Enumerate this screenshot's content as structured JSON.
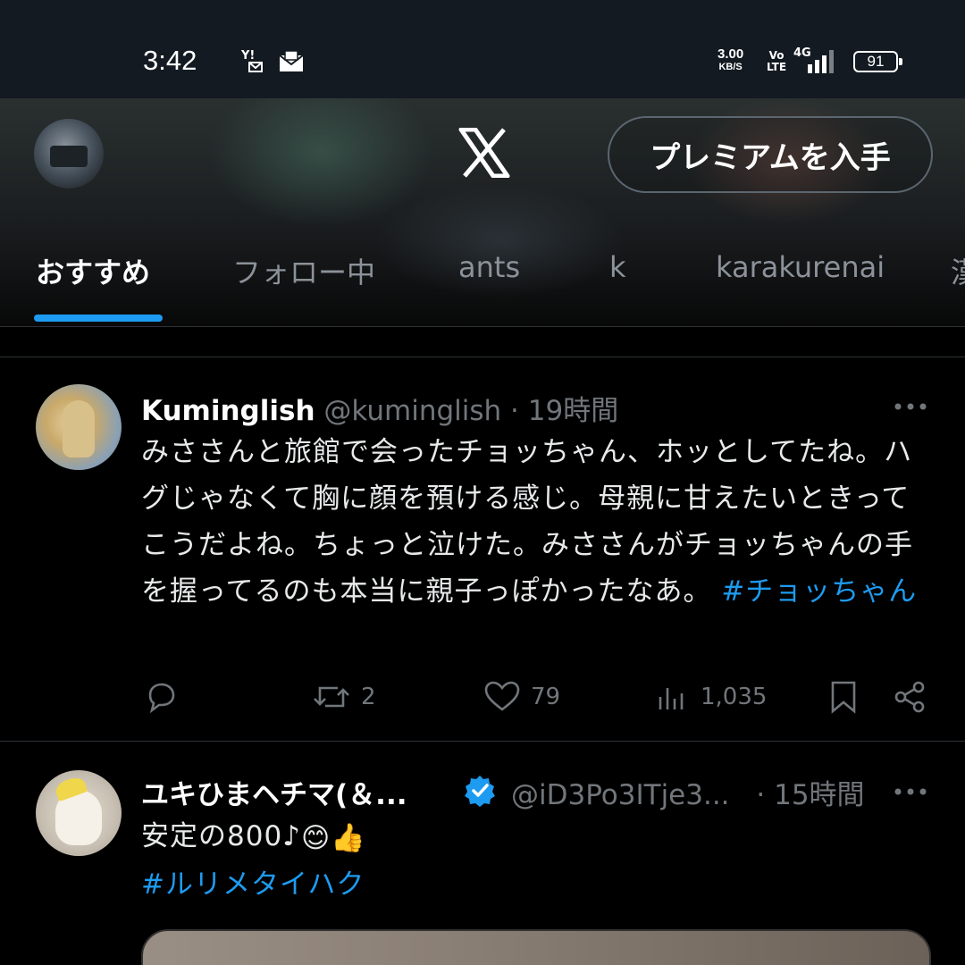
{
  "status_bar": {
    "time": "3:42",
    "notif_icon_1": "Y!",
    "notif_icon_2": "mail-icon",
    "net_speed_value": "3.00",
    "net_speed_unit": "KB/S",
    "volte_top": "Vo",
    "volte_bottom": "LTE",
    "network": "4G",
    "battery": "91"
  },
  "header": {
    "logo": "X",
    "premium_label": "プレミアムを入手"
  },
  "tabs": [
    {
      "label": "おすすめ",
      "active": true
    },
    {
      "label": "フォロー中"
    },
    {
      "label": "ants"
    },
    {
      "label": "k"
    },
    {
      "label": "karakurenai"
    },
    {
      "label": "漢"
    }
  ],
  "tweets": [
    {
      "display_name": "Kuminglish",
      "handle": "@kuminglish",
      "time": "· 19時間",
      "text": "みささんと旅館で会ったチョッちゃん、ホッとしてたね。ハグじゃなくて胸に顔を預ける感じ。母親に甘えたいときってこうだよね。ちょっと泣けた。みささんがチョッちゃんの手を握ってるのも本当に親子っぽかったなあ。",
      "hashtag": "#チョッちゃん",
      "replies": "",
      "retweets": "2",
      "likes": "79",
      "views": "1,035"
    },
    {
      "display_name": "ユキひまヘチマ(＆...",
      "handle": "@iD3Po3ITje3...",
      "time": "· 15時間",
      "text": "安定の800♪",
      "emoji": "😊👍",
      "hashtag": "#ルリメタイハク",
      "verified": true
    }
  ],
  "colors": {
    "accent": "#1d9bf0",
    "background": "#000000",
    "muted": "#71767b",
    "status_bar": "#131a21"
  }
}
